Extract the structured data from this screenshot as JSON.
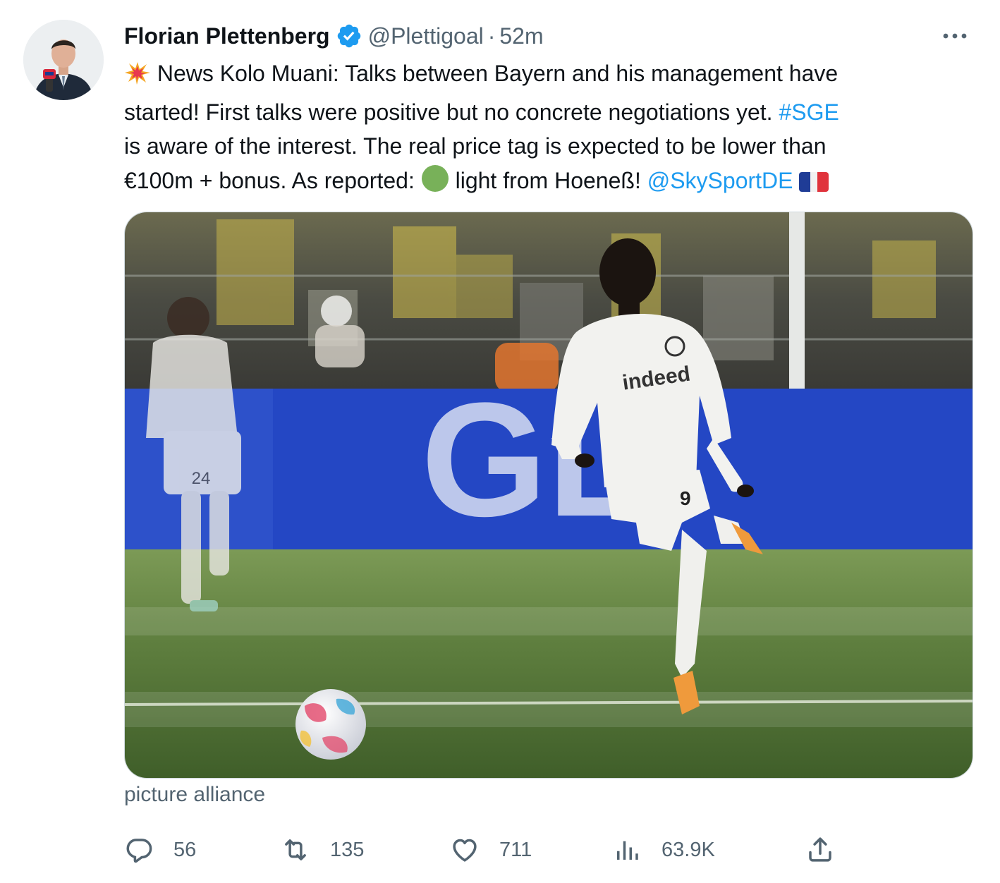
{
  "author": {
    "display_name": "Florian Plettenberg",
    "handle": "@Plettigoal",
    "separator": "·",
    "time": "52m",
    "verified": true
  },
  "tweet": {
    "line1_emoji": "💥",
    "line1_text": "News Kolo Muani: Talks between Bayern and his management have",
    "line2_text": "started! First talks were positive but no concrete negotiations yet. ",
    "line2_hashtag": "#SGE",
    "line3_text": "is aware of the interest. The real price tag is expected to be lower than",
    "line4_text_a": "€100m + bonus. As reported: ",
    "line4_emoji": "🟢",
    "line4_text_b": " light from Hoeneß! ",
    "line4_mention": "@SkySportDE",
    "line4_flag": "🇫🇷"
  },
  "media": {
    "credit": "picture alliance",
    "board_text": "GL",
    "shirt_sponsor": "indeed",
    "shirt_number": "9",
    "bg_player_number": "24"
  },
  "actions": {
    "replies": "56",
    "retweets": "135",
    "likes": "711",
    "views": "63.9K"
  },
  "icons": {
    "verified": "verified-badge-icon",
    "more": "more-dots-icon",
    "reply": "reply-icon",
    "retweet": "retweet-icon",
    "like": "heart-icon",
    "views": "views-chart-icon",
    "share": "share-icon"
  },
  "colors": {
    "accent": "#1d9bf0",
    "text": "#0f1419",
    "muted": "#536471",
    "border": "#cfd9de"
  }
}
